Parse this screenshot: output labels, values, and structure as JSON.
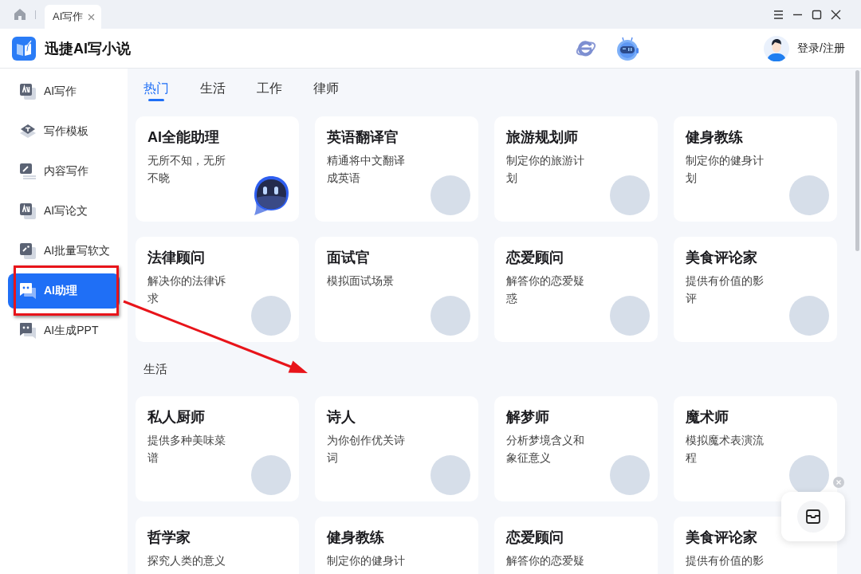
{
  "title_bar": {
    "tabs": [
      {
        "label": "AI写作",
        "selected": true,
        "closable": true
      }
    ]
  },
  "header": {
    "app_name": "迅捷AI写小说",
    "login_label": "登录/注册"
  },
  "sidebar": {
    "items": [
      {
        "label": "AI写作",
        "selected": false
      },
      {
        "label": "写作模板",
        "selected": false
      },
      {
        "label": "内容写作",
        "selected": false
      },
      {
        "label": "AI写论文",
        "selected": false
      },
      {
        "label": "AI批量写软文",
        "selected": false
      },
      {
        "label": "AI助理",
        "selected": true
      },
      {
        "label": "AI生成PPT",
        "selected": false
      }
    ]
  },
  "category_tabs": [
    {
      "label": "热门",
      "selected": true
    },
    {
      "label": "生活",
      "selected": false
    },
    {
      "label": "工作",
      "selected": false
    },
    {
      "label": "律师",
      "selected": false
    }
  ],
  "sections": [
    {
      "cards": [
        {
          "kind": "mascot",
          "title": "AI全能助理",
          "description": "无所不知，无所不晓"
        },
        {
          "kind": "portrait",
          "title": "英语翻译官",
          "description": "精通将中文翻译成英语"
        },
        {
          "kind": "portrait",
          "title": "旅游规划师",
          "description": "制定你的旅游计划"
        },
        {
          "kind": "portrait",
          "title": "健身教练",
          "description": "制定你的健身计划"
        },
        {
          "kind": "portrait",
          "title": "法律顾问",
          "description": "解决你的法律诉求"
        },
        {
          "kind": "portrait",
          "title": "面试官",
          "description": "模拟面试场景"
        },
        {
          "kind": "portrait",
          "title": "恋爱顾问",
          "description": "解答你的恋爱疑惑"
        },
        {
          "kind": "portrait",
          "title": "美食评论家",
          "description": "提供有价值的影评"
        }
      ]
    },
    {
      "heading": "生活",
      "cards": [
        {
          "kind": "portrait",
          "title": "私人厨师",
          "description": "提供多种美味菜谱"
        },
        {
          "kind": "portrait",
          "title": "诗人",
          "description": "为你创作优关诗词"
        },
        {
          "kind": "portrait",
          "title": "解梦师",
          "description": "分析梦境含义和象征意义"
        },
        {
          "kind": "portrait",
          "title": "魔术师",
          "description": "模拟魔术表演流程"
        },
        {
          "kind": "plain",
          "title": "哲学家",
          "description": "探究人类的意义"
        },
        {
          "kind": "plain",
          "title": "健身教练",
          "description": "制定你的健身计"
        },
        {
          "kind": "plain",
          "title": "恋爱顾问",
          "description": "解答你的恋爱疑"
        },
        {
          "kind": "plain",
          "title": "美食评论家",
          "description": "提供有价值的影"
        }
      ]
    }
  ],
  "floating_widget": {
    "close_button": true
  },
  "annotations": {
    "highlight_box": true,
    "arrow": true
  }
}
